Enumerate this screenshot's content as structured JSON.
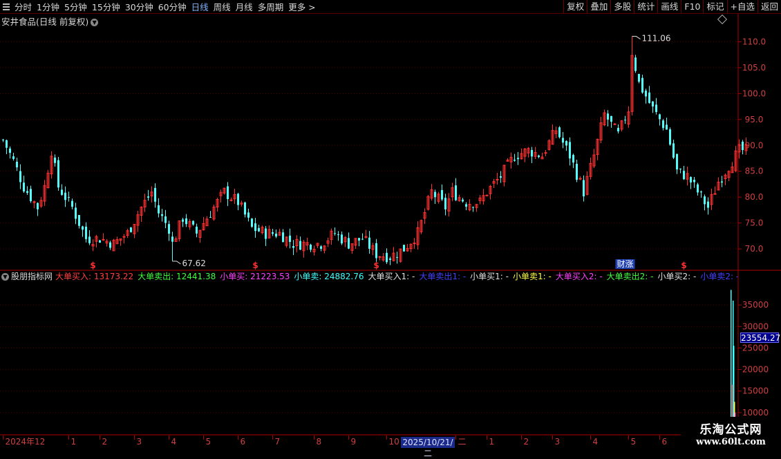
{
  "toolbar": {
    "periods": [
      {
        "label": "分时",
        "active": false
      },
      {
        "label": "1分钟",
        "active": false
      },
      {
        "label": "5分钟",
        "active": false
      },
      {
        "label": "15分钟",
        "active": false
      },
      {
        "label": "30分钟",
        "active": false
      },
      {
        "label": "60分钟",
        "active": false
      },
      {
        "label": "日线",
        "active": true
      },
      {
        "label": "周线",
        "active": false
      },
      {
        "label": "月线",
        "active": false
      },
      {
        "label": "多周期",
        "active": false
      },
      {
        "label": "更多 >",
        "active": false
      }
    ],
    "right": [
      "复权",
      "叠加",
      "多股",
      "统计",
      "画线",
      "F10",
      "标记",
      "+自选",
      "返回"
    ]
  },
  "stock_title": "安井食品(日线 前复权)",
  "indicator": {
    "name": "股朋指标网",
    "items": [
      {
        "label": "大单买入: 13173.22",
        "color": "#ff4040"
      },
      {
        "label": "大单卖出: 12441.38",
        "color": "#40ff40"
      },
      {
        "label": "小单买: 21223.53",
        "color": "#ff40ff"
      },
      {
        "label": "小单卖: 24882.76",
        "color": "#40ffff"
      },
      {
        "label": "大单买入1: -",
        "color": "#e0e0e0"
      },
      {
        "label": "大单卖出1: -",
        "color": "#4040ff"
      },
      {
        "label": "小单买1: -",
        "color": "#e0e0e0"
      },
      {
        "label": "小单卖1: -",
        "color": "#ffff40"
      },
      {
        "label": "大单买入2: -",
        "color": "#ff40ff"
      },
      {
        "label": "大单卖出2: -",
        "color": "#40ff40"
      },
      {
        "label": "小单买2: -",
        "color": "#e0e0e0"
      },
      {
        "label": "小单卖2: -",
        "color": "#4040ff"
      }
    ]
  },
  "current_volume": "23554.27",
  "selected_date": "2025/10/21/二",
  "watermark": {
    "line1": "乐淘公式网",
    "line2": "www.60lt.com"
  },
  "colors": {
    "up": "#ff3232",
    "down": "#54fcfc",
    "axis": "#b00000",
    "label": "#d04040"
  },
  "chart_data": {
    "type": "candlestick",
    "price_ticks": [
      "110.0",
      "105.0",
      "100.0",
      "95.0",
      "90.0",
      "85.0",
      "80.0",
      "75.0",
      "70.0"
    ],
    "ylim": [
      66,
      113
    ],
    "annotations": [
      {
        "label": "111.06",
        "index": 182,
        "value": 111.06
      },
      {
        "label": "67.62",
        "index": 49,
        "value": 67.62
      }
    ],
    "event_markers": [
      {
        "label": "$",
        "index": 26
      },
      {
        "label": "$",
        "index": 73
      },
      {
        "label": "$",
        "index": 108
      },
      {
        "label": "财涨",
        "index": 180
      },
      {
        "label": "$",
        "index": 197
      }
    ],
    "volume_ticks": [
      "35000",
      "30000",
      "25000",
      "20000",
      "15000",
      "10000"
    ],
    "volume_ylim": [
      5000,
      40000
    ],
    "x_labels": [
      {
        "label": "2024年12",
        "index": 0
      },
      {
        "label": "1",
        "index": 19
      },
      {
        "label": "2",
        "index": 28
      },
      {
        "label": "3",
        "index": 38
      },
      {
        "label": "4",
        "index": 48
      },
      {
        "label": "5",
        "index": 58
      },
      {
        "label": "6",
        "index": 68
      },
      {
        "label": "7",
        "index": 78
      },
      {
        "label": "8",
        "index": 90
      },
      {
        "label": "9",
        "index": 100
      },
      {
        "label": "10",
        "index": 111
      },
      {
        "label": "二",
        "index": 131
      },
      {
        "label": "1",
        "index": 140
      },
      {
        "label": "2",
        "index": 150
      },
      {
        "label": "3",
        "index": 159
      },
      {
        "label": "4",
        "index": 170
      },
      {
        "label": "5",
        "index": 181
      },
      {
        "label": "6",
        "index": 190
      }
    ],
    "close_path": [
      [
        0,
        91
      ],
      [
        3,
        87
      ],
      [
        6,
        82
      ],
      [
        10,
        78
      ],
      [
        12,
        82
      ],
      [
        14,
        89
      ],
      [
        16,
        82
      ],
      [
        20,
        78
      ],
      [
        24,
        72
      ],
      [
        28,
        72
      ],
      [
        32,
        71
      ],
      [
        36,
        73
      ],
      [
        40,
        78
      ],
      [
        43,
        81
      ],
      [
        45,
        77
      ],
      [
        48,
        74
      ],
      [
        49,
        71
      ],
      [
        52,
        76
      ],
      [
        56,
        73
      ],
      [
        60,
        77
      ],
      [
        64,
        81
      ],
      [
        68,
        79
      ],
      [
        72,
        74
      ],
      [
        76,
        73
      ],
      [
        80,
        73
      ],
      [
        84,
        71
      ],
      [
        88,
        71
      ],
      [
        92,
        71
      ],
      [
        96,
        73
      ],
      [
        100,
        71
      ],
      [
        104,
        72
      ],
      [
        108,
        69
      ],
      [
        112,
        68.5
      ],
      [
        116,
        70
      ],
      [
        120,
        73
      ],
      [
        124,
        81
      ],
      [
        128,
        78
      ],
      [
        130,
        81
      ],
      [
        134,
        79
      ],
      [
        138,
        79
      ],
      [
        140,
        81
      ],
      [
        144,
        84
      ],
      [
        148,
        88
      ],
      [
        152,
        89
      ],
      [
        156,
        88
      ],
      [
        160,
        93
      ],
      [
        164,
        88
      ],
      [
        168,
        81
      ],
      [
        171,
        88
      ],
      [
        174,
        96
      ],
      [
        178,
        92
      ],
      [
        181,
        97
      ],
      [
        182,
        108
      ],
      [
        184,
        102
      ],
      [
        188,
        97
      ],
      [
        192,
        93
      ],
      [
        195,
        85
      ],
      [
        198,
        84
      ],
      [
        201,
        81
      ],
      [
        204,
        78
      ],
      [
        207,
        83
      ],
      [
        210,
        86
      ],
      [
        213,
        89
      ]
    ]
  }
}
